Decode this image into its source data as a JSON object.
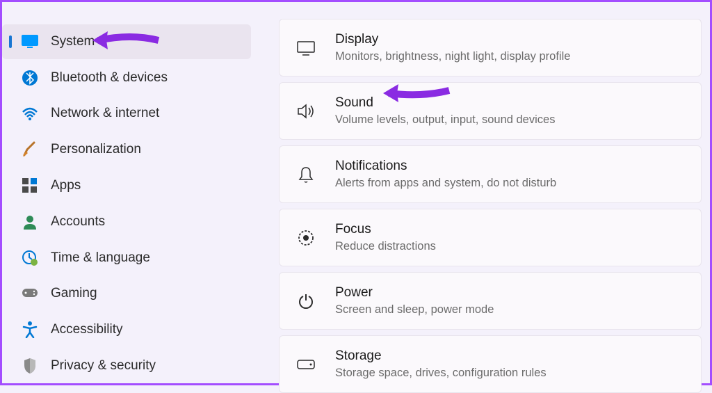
{
  "sidebar": {
    "items": [
      {
        "id": "system",
        "label": "System",
        "icon": "display-icon",
        "active": true
      },
      {
        "id": "bluetooth",
        "label": "Bluetooth & devices",
        "icon": "bluetooth-icon",
        "active": false
      },
      {
        "id": "network",
        "label": "Network & internet",
        "icon": "wifi-icon",
        "active": false
      },
      {
        "id": "personalization",
        "label": "Personalization",
        "icon": "paintbrush-icon",
        "active": false
      },
      {
        "id": "apps",
        "label": "Apps",
        "icon": "apps-icon",
        "active": false
      },
      {
        "id": "accounts",
        "label": "Accounts",
        "icon": "person-icon",
        "active": false
      },
      {
        "id": "time",
        "label": "Time & language",
        "icon": "clock-globe-icon",
        "active": false
      },
      {
        "id": "gaming",
        "label": "Gaming",
        "icon": "gamepad-icon",
        "active": false
      },
      {
        "id": "accessibility",
        "label": "Accessibility",
        "icon": "accessibility-icon",
        "active": false
      },
      {
        "id": "privacy",
        "label": "Privacy & security",
        "icon": "shield-icon",
        "active": false
      }
    ]
  },
  "main": {
    "cards": [
      {
        "id": "display",
        "title": "Display",
        "subtitle": "Monitors, brightness, night light, display profile",
        "icon": "monitor-icon"
      },
      {
        "id": "sound",
        "title": "Sound",
        "subtitle": "Volume levels, output, input, sound devices",
        "icon": "speaker-icon"
      },
      {
        "id": "notifications",
        "title": "Notifications",
        "subtitle": "Alerts from apps and system, do not disturb",
        "icon": "bell-icon"
      },
      {
        "id": "focus",
        "title": "Focus",
        "subtitle": "Reduce distractions",
        "icon": "focus-icon"
      },
      {
        "id": "power",
        "title": "Power",
        "subtitle": "Screen and sleep, power mode",
        "icon": "power-icon"
      },
      {
        "id": "storage",
        "title": "Storage",
        "subtitle": "Storage space, drives, configuration rules",
        "icon": "drive-icon"
      }
    ]
  },
  "annotations": {
    "arrow_color": "#8a2be2"
  }
}
